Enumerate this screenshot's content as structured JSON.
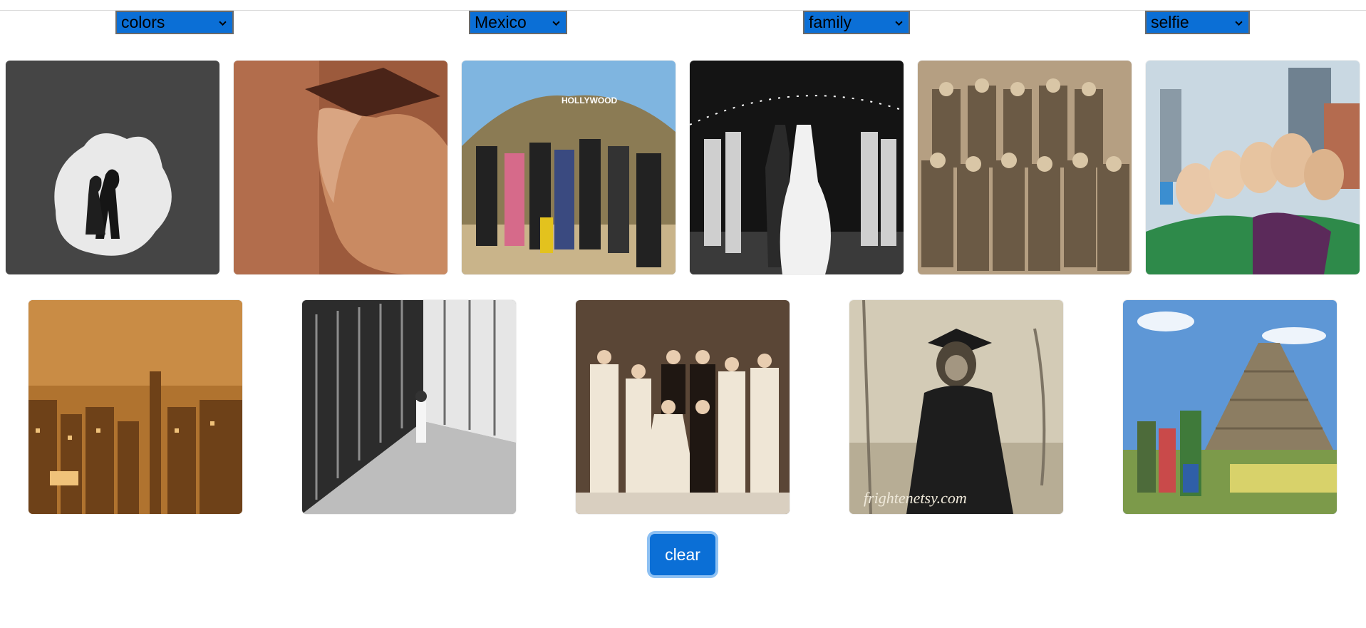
{
  "filters": [
    {
      "name": "dropdown-colors",
      "selected": "colors"
    },
    {
      "name": "dropdown-location",
      "selected": "Mexico"
    },
    {
      "name": "dropdown-people",
      "selected": "family"
    },
    {
      "name": "dropdown-style",
      "selected": "selfie"
    }
  ],
  "images": {
    "row1": [
      {
        "label": "couple silhouette bw",
        "watermark": ""
      },
      {
        "label": "graduate sepia",
        "watermark": ""
      },
      {
        "label": "family hollywood",
        "watermark": "Hollywood"
      },
      {
        "label": "wedding sparklers bw",
        "watermark": ""
      },
      {
        "label": "graduates vintage group",
        "watermark": ""
      },
      {
        "label": "friends selfie city",
        "watermark": ""
      }
    ],
    "row2": [
      {
        "label": "city skyline sepia",
        "watermark": ""
      },
      {
        "label": "corridor bw",
        "watermark": ""
      },
      {
        "label": "vintage wedding party",
        "watermark": ""
      },
      {
        "label": "sloth graduate",
        "watermark": "frightenetsy.com"
      },
      {
        "label": "pyramid family",
        "watermark": ""
      }
    ]
  },
  "buttons": {
    "clear": "clear"
  },
  "colors": {
    "accent": "#0b6fd6",
    "focus_ring": "#8ec1f3"
  }
}
